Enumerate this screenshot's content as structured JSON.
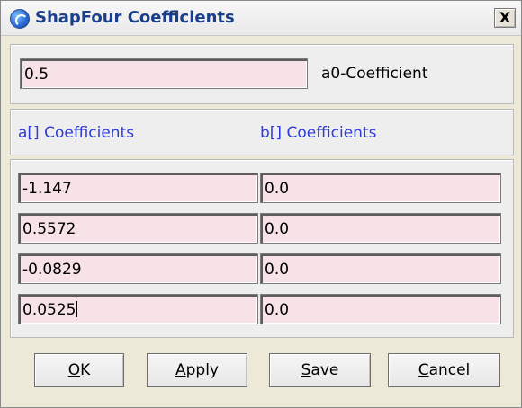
{
  "window": {
    "title": "ShapFour Coefficients",
    "close_label": "X"
  },
  "a0": {
    "value": "0.5",
    "label": "a0-Coefficient"
  },
  "headers": {
    "a_label": "a[] Coefficients",
    "b_label": "b[] Coefficients"
  },
  "rows": [
    {
      "a": "-1.147",
      "b": "0.0"
    },
    {
      "a": "0.5572",
      "b": "0.0"
    },
    {
      "a": "-0.0829",
      "b": "0.0"
    },
    {
      "a": "0.0525",
      "b": "0.0"
    }
  ],
  "buttons": {
    "ok": {
      "mnemonic": "O",
      "rest": "K"
    },
    "apply": {
      "mnemonic": "A",
      "rest": "pply"
    },
    "save": {
      "mnemonic": "S",
      "rest": "ave"
    },
    "cancel": {
      "mnemonic": "C",
      "rest": "ancel"
    }
  },
  "colors": {
    "field_bg": "#f7e3e7",
    "header_blue": "#2f3bd6",
    "title_blue": "#1b3e8a"
  },
  "icons": {
    "app": "app-globe-icon",
    "close": "close-icon"
  }
}
